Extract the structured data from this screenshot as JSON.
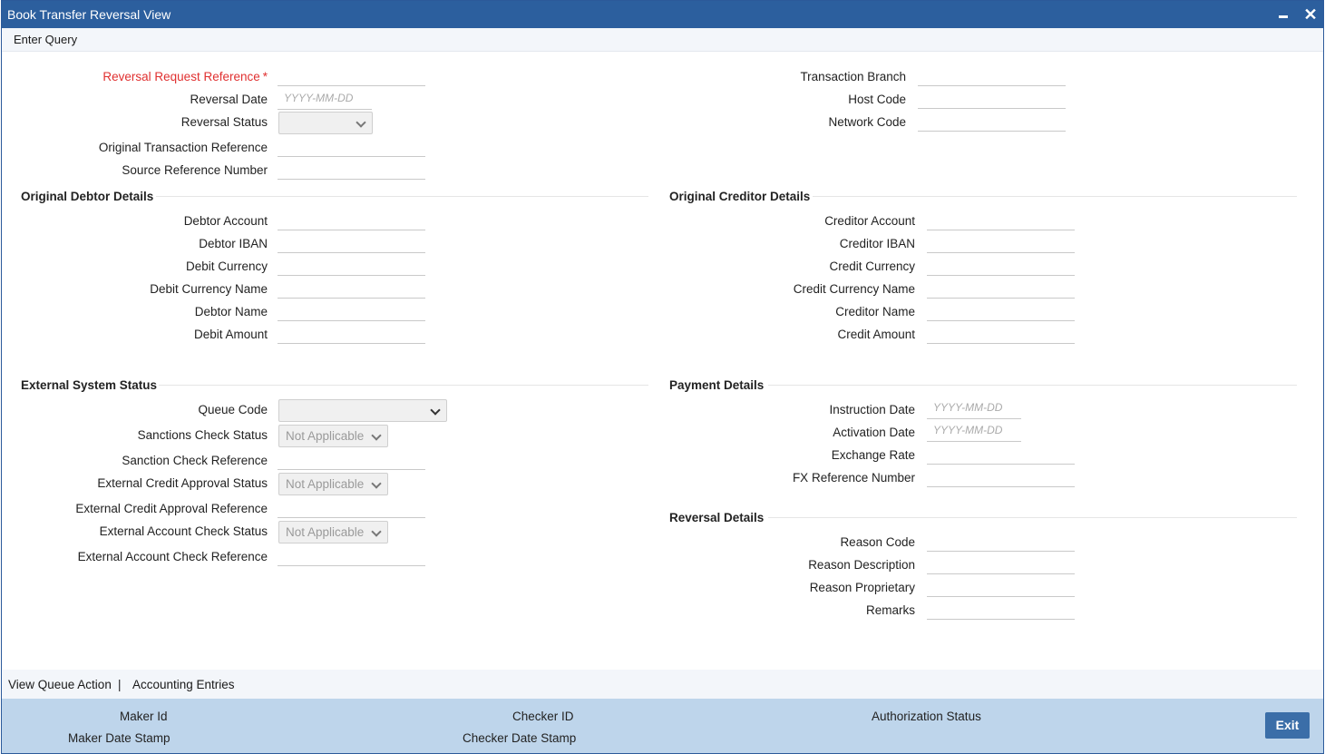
{
  "window": {
    "title": "Book Transfer Reversal View",
    "minimize_icon": "minimize-icon",
    "close_glyph": "✕"
  },
  "menu": {
    "enter_query": "Enter Query"
  },
  "header_left": {
    "reversal_request_reference": "Reversal Request Reference",
    "required_star": "*",
    "reversal_date": "Reversal Date",
    "reversal_date_placeholder": "YYYY-MM-DD",
    "reversal_status": "Reversal Status",
    "original_transaction_reference": "Original Transaction Reference",
    "source_reference_number": "Source Reference Number"
  },
  "header_right": {
    "transaction_branch": "Transaction Branch",
    "host_code": "Host Code",
    "network_code": "Network Code"
  },
  "debtor": {
    "section": "Original Debtor Details",
    "debtor_account": "Debtor Account",
    "debtor_iban": "Debtor IBAN",
    "debit_currency": "Debit Currency",
    "debit_currency_name": "Debit Currency Name",
    "debtor_name": "Debtor Name",
    "debit_amount": "Debit Amount"
  },
  "creditor": {
    "section": "Original Creditor Details",
    "creditor_account": "Creditor Account",
    "creditor_iban": "Creditor IBAN",
    "credit_currency": "Credit Currency",
    "credit_currency_name": "Credit Currency Name",
    "creditor_name": "Creditor Name",
    "credit_amount": "Credit Amount"
  },
  "external": {
    "section": "External System Status",
    "queue_code": "Queue Code",
    "sanctions_check_status": "Sanctions Check Status",
    "sanctions_check_status_value": "Not Applicable",
    "sanction_check_reference": "Sanction Check Reference",
    "external_credit_approval_status": "External Credit Approval Status",
    "external_credit_approval_status_value": "Not Applicable",
    "external_credit_approval_reference": "External Credit Approval Reference",
    "external_account_check_status": "External Account Check Status",
    "external_account_check_status_value": "Not Applicable",
    "external_account_check_reference": "External Account Check Reference"
  },
  "payment": {
    "section": "Payment Details",
    "instruction_date": "Instruction Date",
    "instruction_date_placeholder": "YYYY-MM-DD",
    "activation_date": "Activation Date",
    "activation_date_placeholder": "YYYY-MM-DD",
    "exchange_rate": "Exchange Rate",
    "fx_reference_number": "FX Reference Number"
  },
  "reversal": {
    "section": "Reversal Details",
    "reason_code": "Reason Code",
    "reason_description": "Reason Description",
    "reason_proprietary": "Reason Proprietary",
    "remarks": "Remarks"
  },
  "bottom_links": {
    "view_queue_action": "View Queue Action",
    "separator": "|",
    "accounting_entries": "Accounting Entries"
  },
  "footer": {
    "maker_id": "Maker Id",
    "maker_date_stamp": "Maker Date Stamp",
    "checker_id": "Checker ID",
    "checker_date_stamp": "Checker Date Stamp",
    "authorization_status": "Authorization Status",
    "exit": "Exit"
  },
  "colors": {
    "title_bar": "#2c5f9e",
    "required": "#e03030",
    "footer": "#bed5eb",
    "exit_button": "#3b6ea8"
  }
}
